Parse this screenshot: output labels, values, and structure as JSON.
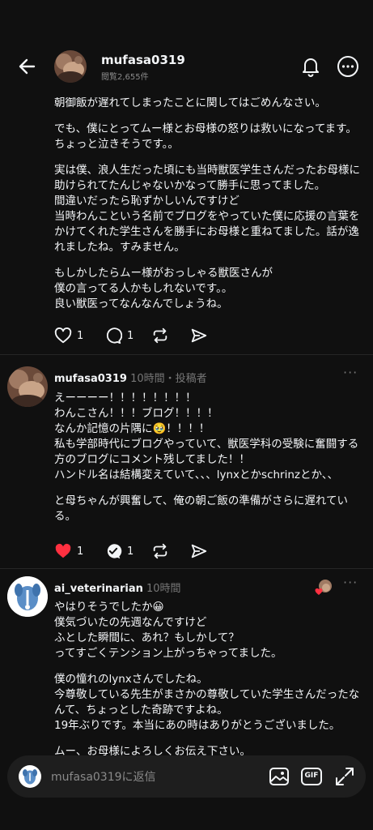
{
  "header": {
    "username": "mufasa0319",
    "views": "閲覧2,655件"
  },
  "post1": {
    "paragraphs": [
      [
        "朝御飯が遅れてしまったことに関してはごめんなさい。"
      ],
      [
        "でも、僕にとってムー様とお母様の怒りは救いになってます。ちょっと泣きそうです。。"
      ],
      [
        "実は僕、浪人生だった頃にも当時獣医学生さんだったお母様に助けられてたんじゃないかなって勝手に思ってました。",
        "間違いだったら恥ずかしいんですけど",
        "当時わんこという名前でブログをやっていた僕に応援の言葉をかけてくれた学生さんを勝手にお母様と重ねてました。話が逸れましたね。すみません。"
      ],
      [
        "もしかしたらムー様がおっしゃる獣医さんが",
        "僕の言ってる人かもしれないです。。",
        "良い獣医ってなんなんでしょうね。"
      ]
    ],
    "like_count": "1",
    "reply_count": "1"
  },
  "post2": {
    "username": "mufasa0319",
    "meta": "10時間・投稿者",
    "paragraphs": [
      [
        "えーーーー！！！！！！！！",
        "わんこさん！！！ブログ！！！！",
        "なんか記憶の片隅に🥹！！！！",
        "私も学部時代にブログやっていて、獣医学科の受験に奮闘する方のブログにコメント残してました！！",
        "ハンドル名は結構変えていて、、、lynxとかschrinzとか、、"
      ],
      [
        "と母ちゃんが興奮して、俺の朝ご飯の準備がさらに遅れている。"
      ]
    ],
    "like_count": "1",
    "reply_count": "1"
  },
  "post3": {
    "username": "ai_veterinarian",
    "meta": "10時間",
    "paragraphs": [
      [
        "やはりそうでしたか😀",
        "僕気づいたの先週なんですけど",
        "ふとした瞬間に、あれ？もしかして？",
        "ってすごくテンション上がっちゃってました。"
      ],
      [
        "僕の憧れのlynxさんでしたね。",
        "今尊敬している先生がまさかの尊敬していた学生さんだったなんて、ちょっとした奇跡ですよね。",
        "19年ぶりです。本当にあの時はありがとうございました。"
      ],
      [
        "ムー、お母様によろしくお伝え下さい。"
      ]
    ]
  },
  "reply_bar": {
    "placeholder": "mufasa0319に返信",
    "gif_label": "GIF"
  },
  "colors": {
    "background": "#101010",
    "like_red": "#ff3040",
    "text": "#f3f5f7",
    "muted": "#777777"
  },
  "icons": [
    "back-arrow-icon",
    "bell-icon",
    "more-icon",
    "heart-icon",
    "comment-icon",
    "repost-icon",
    "share-icon",
    "image-icon",
    "gif-icon",
    "expand-icon"
  ]
}
